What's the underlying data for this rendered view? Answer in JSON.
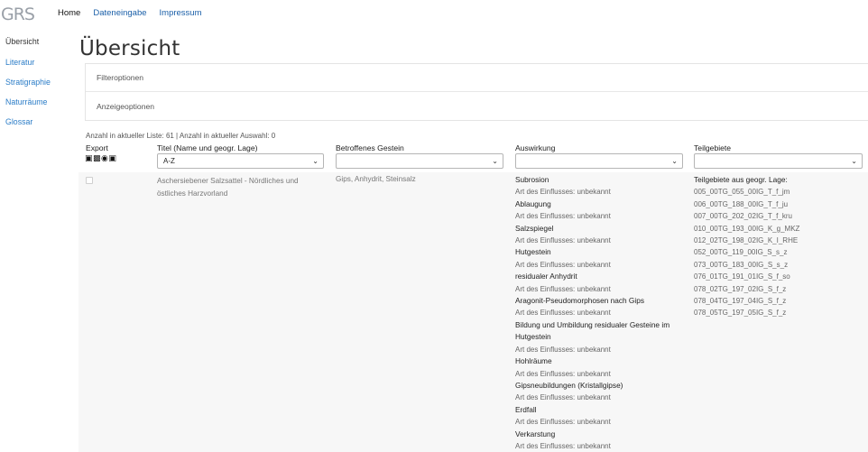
{
  "header": {
    "logo_text": "GRS",
    "nav": [
      {
        "label": "Home",
        "active": true
      },
      {
        "label": "Dateneingabe",
        "active": false
      },
      {
        "label": "Impressum",
        "active": false
      }
    ]
  },
  "sidebar": {
    "items": [
      {
        "label": "Übersicht",
        "active": true
      },
      {
        "label": "Literatur",
        "active": false
      },
      {
        "label": "Stratigraphie",
        "active": false
      },
      {
        "label": "Naturräume",
        "active": false
      },
      {
        "label": "Glossar",
        "active": false
      }
    ]
  },
  "page_title": "Übersicht",
  "panels": {
    "filter_label": "Filteroptionen",
    "display_label": "Anzeigeoptionen"
  },
  "count_text": "Anzahl in aktueller Liste: 61 | Anzahl in aktueller Auswahl: 0",
  "table": {
    "headers": {
      "export": "Export",
      "title": "Titel (Name und geogr. Lage)",
      "rock": "Betroffenes Gestein",
      "effect": "Auswirkung",
      "parts": "Teilgebiete"
    },
    "export_icons": "▣▩◉▣",
    "title_select_value": "A-Z",
    "rock_select_value": "",
    "effect_select_value": "",
    "parts_select_value": "",
    "row": {
      "title": "Aschersiebener Salzsattel - Nördliches und östliches Harzvorland",
      "rock": "Gips, Anhydrit, Steinsalz",
      "effects": [
        {
          "name": "Subrosion",
          "sub": "Art des Einflusses: unbekannt"
        },
        {
          "name": "Ablaugung",
          "sub": "Art des Einflusses: unbekannt"
        },
        {
          "name": "Salzspiegel",
          "sub": "Art des Einflusses: unbekannt"
        },
        {
          "name": "Hutgestein",
          "sub": "Art des Einflusses: unbekannt"
        },
        {
          "name": "residualer Anhydrit",
          "sub": "Art des Einflusses: unbekannt"
        },
        {
          "name": "Aragonit-Pseudomorphosen nach Gips",
          "sub": "Art des Einflusses: unbekannt"
        },
        {
          "name": "Bildung und Umbildung residualer Gesteine im Hutgestein",
          "sub": "Art des Einflusses: unbekannt"
        },
        {
          "name": "Hohlräume",
          "sub": "Art des Einflusses: unbekannt"
        },
        {
          "name": "Gipsneubildungen (Kristallgipse)",
          "sub": "Art des Einflusses: unbekannt"
        },
        {
          "name": "Erdfall",
          "sub": "Art des Einflusses: unbekannt"
        },
        {
          "name": "Verkarstung",
          "sub": "Art des Einflusses: unbekannt"
        }
      ],
      "parts_heading": "Teilgebiete aus geogr. Lage:",
      "parts": [
        "005_00TG_055_00IG_T_f_jm",
        "006_00TG_188_00IG_T_f_ju",
        "007_00TG_202_02IG_T_f_kru",
        "010_00TG_193_00IG_K_g_MKZ",
        "012_02TG_198_02IG_K_I_RHE",
        "052_00TG_119_00IG_S_s_z",
        "073_00TG_183_00IG_S_s_z",
        "076_01TG_191_01IG_S_f_so",
        "078_02TG_197_02IG_S_f_z",
        "078_04TG_197_04IG_S_f_z",
        "078_05TG_197_05IG_S_f_z"
      ]
    }
  },
  "colors": {
    "link": "#1a5fa8",
    "sidebar_link": "#2a7cc7",
    "row_bg": "#f7f7f7"
  }
}
